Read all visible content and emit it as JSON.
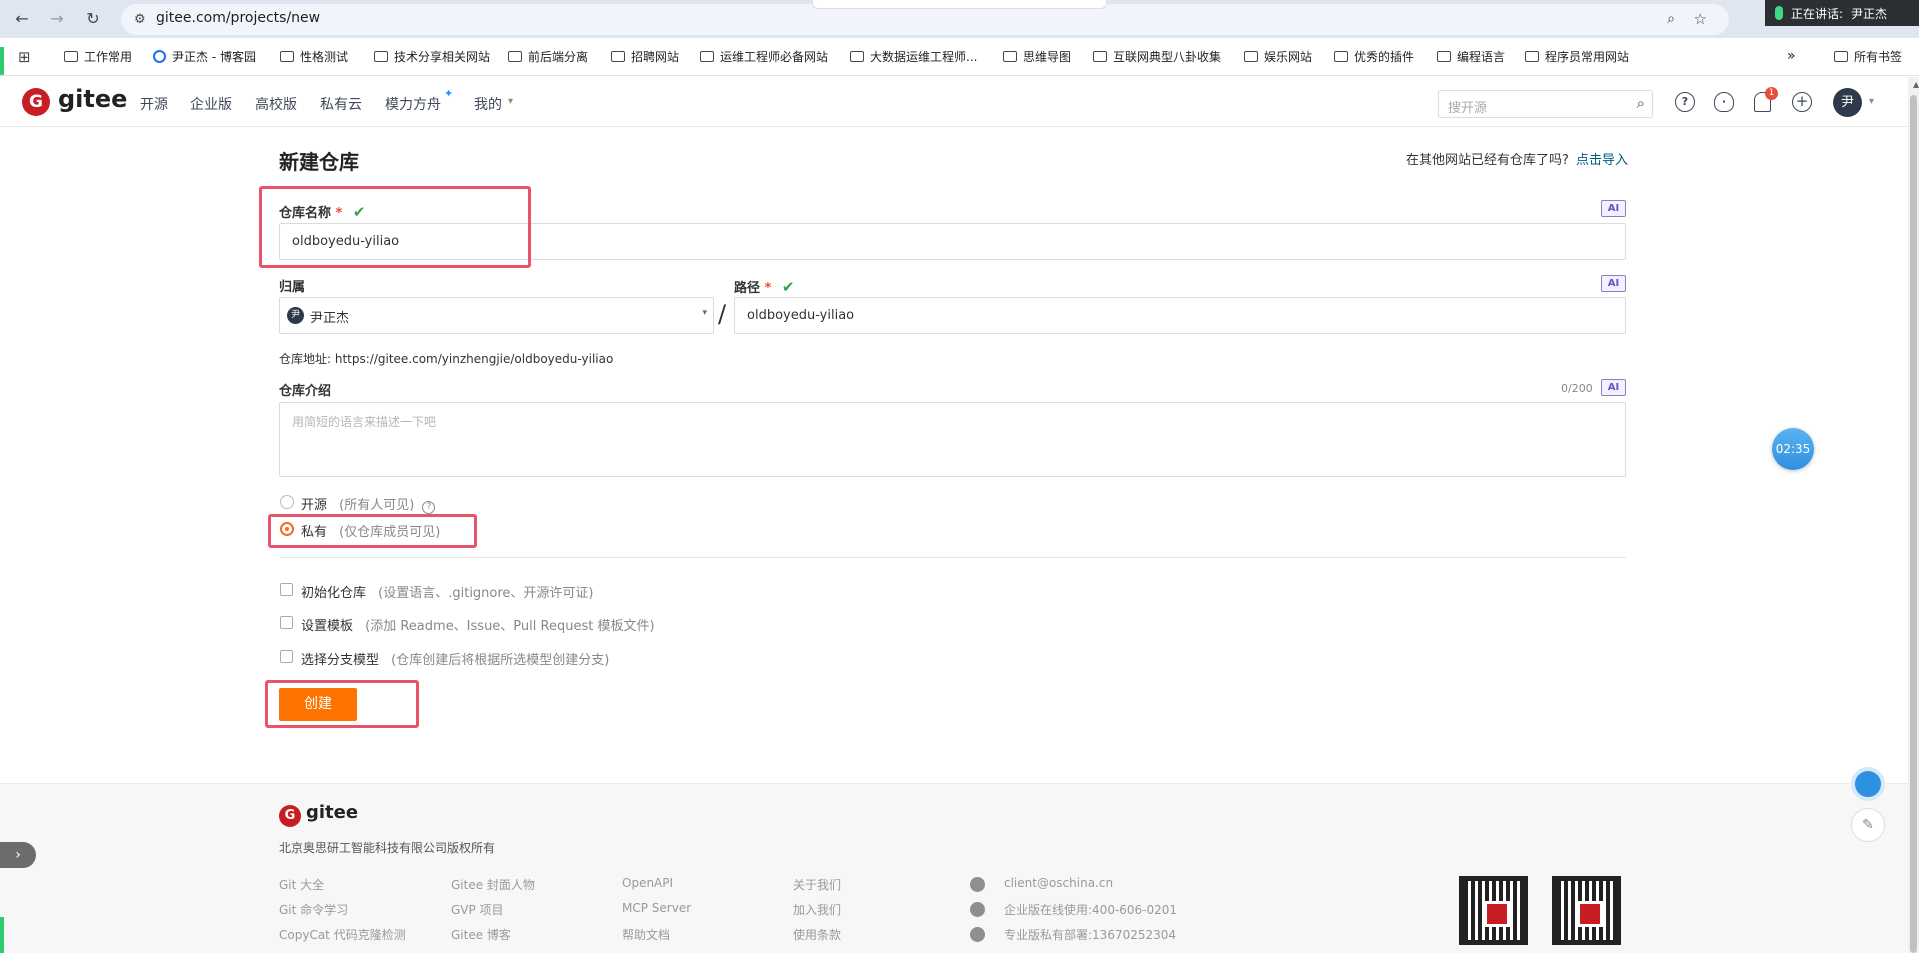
{
  "browser": {
    "url": "gitee.com/projects/new",
    "speaking_label": "正在讲话:",
    "speaking_user": "尹正杰",
    "bookmarks": [
      "工作常用",
      "尹正杰 - 博客园",
      "性格测试",
      "技术分享相关网站",
      "前后端分离",
      "招聘网站",
      "运维工程师必备网站",
      "大数据运维工程师...",
      "思维导图",
      "互联网典型八卦收集",
      "娱乐网站",
      "优秀的插件",
      "编程语言",
      "程序员常用网站"
    ],
    "more_bookmarks": "»",
    "all_bookmarks": "所有书签"
  },
  "header": {
    "logo_text": "gitee",
    "nav": [
      "开源",
      "企业版",
      "高校版",
      "私有云",
      "模力方舟",
      "我的"
    ],
    "search_placeholder": "搜开源",
    "notification_count": "1",
    "avatar_text": "尹"
  },
  "form": {
    "title": "新建仓库",
    "import_prompt": "在其他网站已经有仓库了吗?",
    "import_link": "点击导入",
    "repo_name_label": "仓库名称",
    "repo_name_value": "oldboyedu-yiliao",
    "owner_label": "归属",
    "owner_value": "尹正杰",
    "owner_avatar": "尹",
    "path_label": "路径",
    "path_value": "oldboyedu-yiliao",
    "separator": "/",
    "repo_address": "仓库地址: https://gitee.com/yinzhengjie/oldboyedu-yiliao",
    "intro_label": "仓库介绍",
    "intro_count": "0/200",
    "intro_placeholder": "用简短的语言来描述一下吧",
    "ai_badge": "AI",
    "required_mark": "*",
    "check_mark": "✔",
    "visibility": {
      "public_label": "开源",
      "public_note": "(所有人可见)",
      "private_label": "私有",
      "private_note": "(仅仓库成员可见)",
      "selected": "private"
    },
    "options": [
      {
        "label": "初始化仓库",
        "note": "(设置语言、.gitignore、开源许可证)"
      },
      {
        "label": "设置模板",
        "note": "(添加 Readme、Issue、Pull Request 模板文件)"
      },
      {
        "label": "选择分支模型",
        "note": "(仓库创建后将根据所选模型创建分支)"
      }
    ],
    "create_button": "创建"
  },
  "timer": "02:35",
  "footer": {
    "logo_text": "gitee",
    "copyright": "北京奥思研工智能科技有限公司版权所有",
    "col1": [
      "Git 大全",
      "Git 命令学习",
      "CopyCat 代码克隆检测"
    ],
    "col2": [
      "Gitee 封面人物",
      "GVP 项目",
      "Gitee 博客"
    ],
    "col3": [
      "OpenAPI",
      "MCP Server",
      "帮助文档"
    ],
    "col4": [
      "关于我们",
      "加入我们",
      "使用条款"
    ],
    "contacts": [
      "client@oschina.cn",
      "企业版在线使用:400-606-0201",
      "专业版私有部署:13670252304"
    ]
  }
}
